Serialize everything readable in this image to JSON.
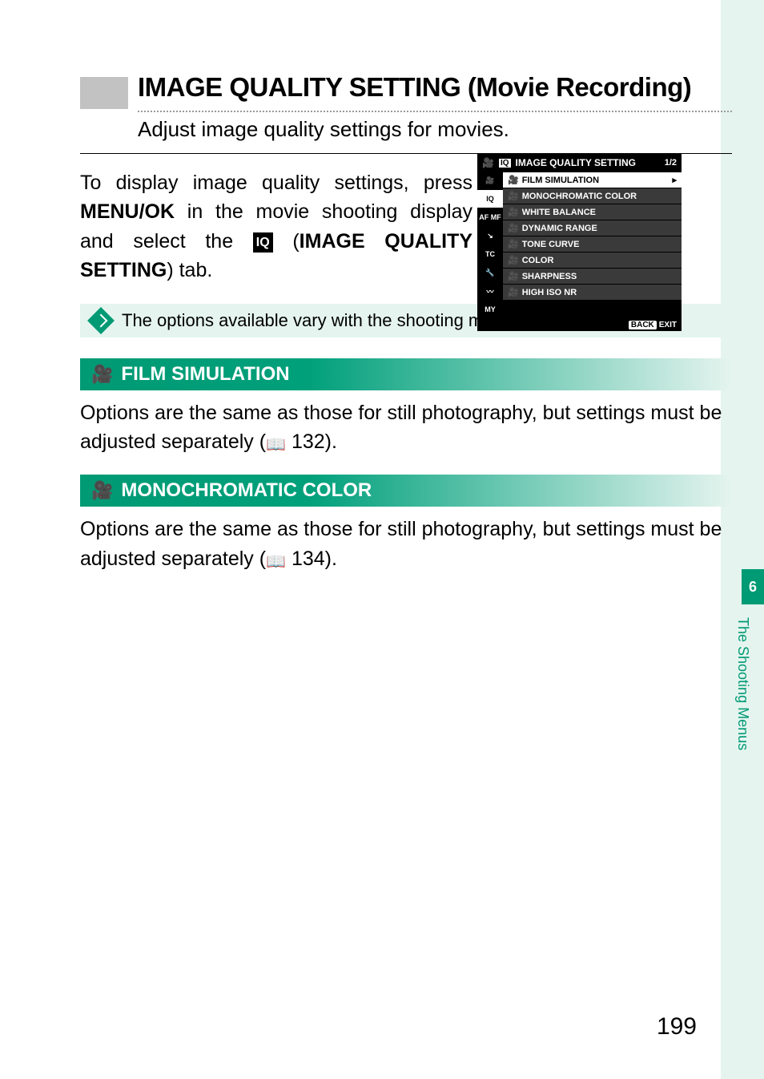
{
  "heading": {
    "title": "IMAGE QUALITY SETTING (Movie Recording)",
    "subtitle": "Adjust image quality settings for movies."
  },
  "intro": {
    "line1": "To display image quality settings, press ",
    "kbd": "MENU/OK",
    "line2": " in the movie shooting display and select the ",
    "badge": "IQ",
    "line3": " (",
    "bold": "IMAGE QUALITY SETTING",
    "line4": ") tab."
  },
  "menu": {
    "header_icon": "IQ",
    "header_title": "IMAGE QUALITY SETTING",
    "pager_current": "1",
    "pager_total": "/2",
    "tabs": [
      "🎥",
      "IQ",
      "AF MF",
      "↘",
      "TC",
      "🔧",
      "〰",
      "MY"
    ],
    "selected_tab_index": 1,
    "items": [
      "FILM SIMULATION",
      "MONOCHROMATIC COLOR",
      "WHITE BALANCE",
      "DYNAMIC RANGE",
      "TONE CURVE",
      "COLOR",
      "SHARPNESS",
      "HIGH ISO NR"
    ],
    "selected_item_index": 0,
    "footer_back": "BACK",
    "footer_exit": "EXIT"
  },
  "note": "The options available vary with the shooting mode selected.",
  "sections": [
    {
      "title": "FILM SIMULATION",
      "body_a": "Options are the same as those for still photography, but settings must be adjusted separately (",
      "page_ref": "132",
      "body_b": ")."
    },
    {
      "title": "MONOCHROMATIC COLOR",
      "body_a": "Options are the same as those for still photography, but settings must be adjusted separately (",
      "page_ref": "134",
      "body_b": ")."
    }
  ],
  "side": {
    "chapter": "6",
    "label": "The Shooting Menus"
  },
  "page_number": "199"
}
